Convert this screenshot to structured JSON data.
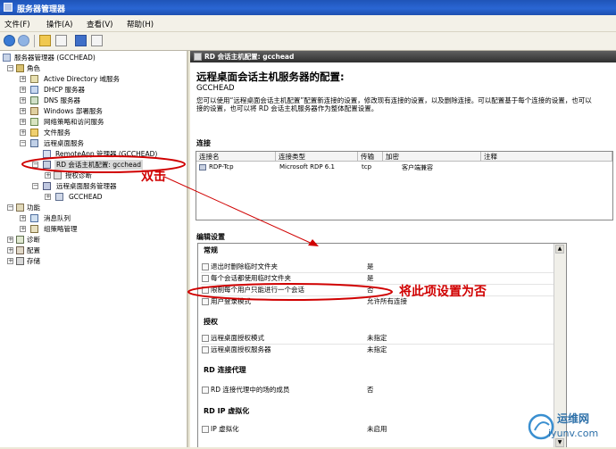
{
  "window": {
    "title": "服务器管理器"
  },
  "menu": [
    "文件(F)",
    "操作(A)",
    "查看(V)",
    "帮助(H)"
  ],
  "tree": {
    "root": "服务器管理器 (GCCHEAD)",
    "roles": "角色",
    "ad": "Active Directory 域服务",
    "dhcp": "DHCP 服务器",
    "dns": "DNS 服务器",
    "wds": "Windows 部署服务",
    "npas": "网络策略和访问服务",
    "file": "文件服务",
    "rds": "远程桌面服务",
    "remoteapp": "RemoteApp 管理器 (GCCHEAD)",
    "rdhost": "RD 会话主机配置: gcchead",
    "licdiag": "授权诊断",
    "rdsmgr": "远程桌面服务管理器",
    "gcchead": "GCCHEAD",
    "features": "功能",
    "msmq": "消息队列",
    "gpm": "组策略管理",
    "diag": "诊断",
    "config": "配置",
    "storage": "存储"
  },
  "panel": {
    "banner": "RD 会话主机配置: gcchead",
    "heading": "远程桌面会话主机服务器的配置:",
    "server": "GCCHEAD",
    "desc1": "您可以使用“远程桌面会话主机配置”配置新连接的设置，修改现有连接的设置，以及删除连接。可以配置基于每个连接的设置，也可以",
    "desc2": "接的设置，也可以将 RD 会话主机服务器作为整体配置设置。",
    "connections_title": "连接",
    "columns": [
      "连接名",
      "连接类型",
      "传输",
      "加密",
      "注释"
    ],
    "connection_row": [
      "RDP-Tcp",
      "Microsoft RDP 6.1",
      "tcp",
      "客户端兼容",
      ""
    ],
    "edit_title": "编辑设置",
    "groups": {
      "general": "常规",
      "licensing": "授权",
      "broker": "RD 连接代理",
      "ipv": "RD IP 虚拟化"
    },
    "settings": [
      {
        "label": "退出时删除临时文件夹",
        "value": "是"
      },
      {
        "label": "每个会话都使用临时文件夹",
        "value": "是"
      },
      {
        "label": "限制每个用户只能进行一个会话",
        "value": "否"
      },
      {
        "label": "用户登录模式",
        "value": "允许所有连接"
      },
      {
        "label": "远程桌面授权模式",
        "value": "未指定"
      },
      {
        "label": "远程桌面授权服务器",
        "value": "未指定"
      },
      {
        "label": "RD 连接代理中的场的成员",
        "value": "否"
      },
      {
        "label": "IP 虚拟化",
        "value": "未启用"
      }
    ]
  },
  "annotations": {
    "doubleclick": "双击",
    "set_no": "将此项设置为否"
  },
  "watermark": {
    "brand": "运维网",
    "url": "iyunv.com"
  },
  "colors": {
    "annotation": "#d00000",
    "title_bar": "#2a66d3"
  }
}
